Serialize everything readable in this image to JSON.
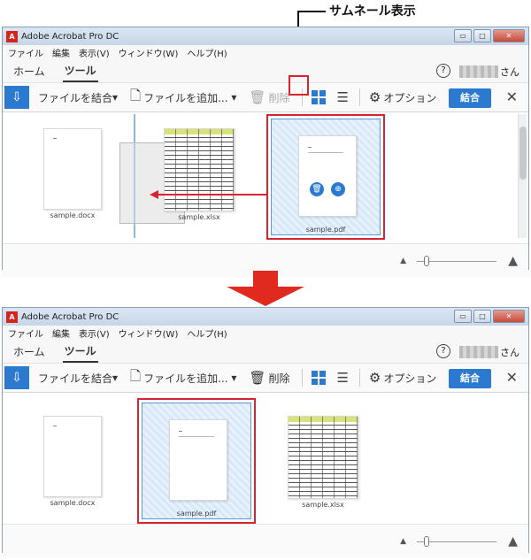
{
  "callout": {
    "label": "サムネール表示"
  },
  "window": {
    "title": "Adobe Acrobat Pro DC",
    "logo": "A",
    "controls": {
      "minimize": "▭",
      "maximize": "□",
      "close": "✕"
    }
  },
  "menu": [
    "ファイル",
    "編集",
    "表示(V)",
    "ウィンドウ(W)",
    "ヘルプ(H)"
  ],
  "tabs": {
    "home": "ホーム",
    "tools": "ツール"
  },
  "help_icon": "?",
  "user_suffix": "さん",
  "toolbar": {
    "combine_files": "ファイルを結合",
    "add_files": "ファイルを追加...",
    "delete": "削除",
    "options": "オプション",
    "combine_button": "結合",
    "close": "✕"
  },
  "before": {
    "files": [
      "sample.docx",
      "sample.xlsx",
      "sample.pdf"
    ]
  },
  "after": {
    "files": [
      "sample.docx",
      "sample.pdf",
      "sample.xlsx"
    ]
  },
  "colors": {
    "accent": "#2c7ad0",
    "highlight": "#d9232f"
  }
}
